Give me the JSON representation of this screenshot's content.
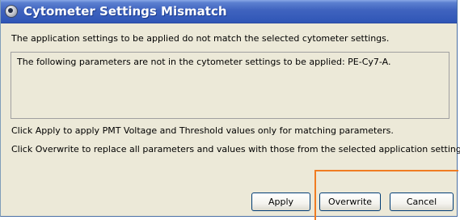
{
  "dialog": {
    "title": "Cytometer Settings Mismatch",
    "message": "The application settings to be applied do not match the selected cytometer settings.",
    "details": "The following parameters are not in the cytometer settings to be applied: PE-Cy7-A.",
    "instruction_apply": "Click Apply to apply PMT Voltage and Threshold values only for matching parameters.",
    "instruction_overwrite": "Click Overwrite to replace all parameters and values with those from the selected application settings."
  },
  "buttons": {
    "apply": "Apply",
    "overwrite": "Overwrite",
    "cancel": "Cancel"
  },
  "colors": {
    "titlebar": "#2f56b6",
    "highlight": "#f07c22",
    "background": "#ece9d8"
  }
}
